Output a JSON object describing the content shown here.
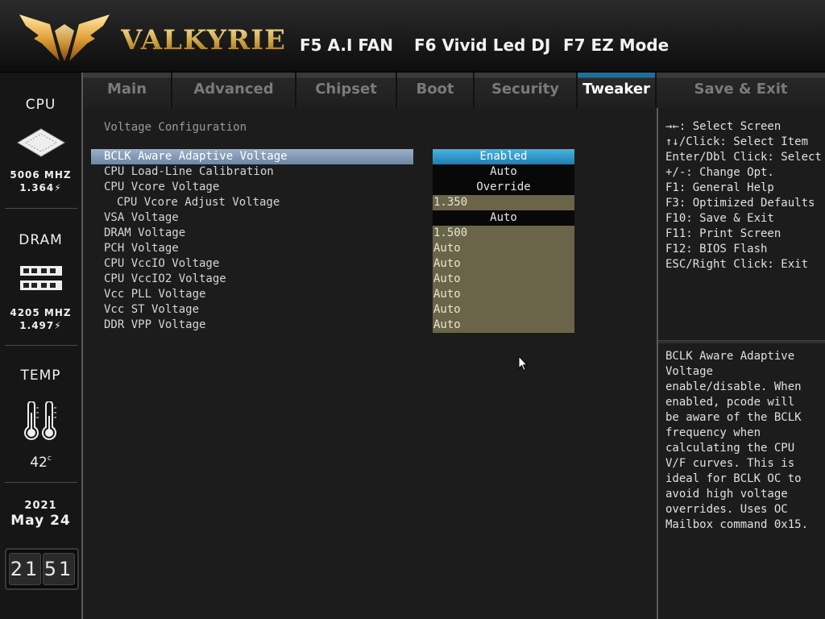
{
  "header": {
    "brand": "VALKYRIE",
    "hotkeys": [
      "F5 A.I FAN",
      "F6 Vivid Led DJ",
      "F7 EZ Mode"
    ]
  },
  "status": {
    "cpu": {
      "title": "CPU",
      "freq": "5006 MHZ",
      "volt": "1.364"
    },
    "dram": {
      "title": "DRAM",
      "freq": "4205 MHZ",
      "volt": "1.497"
    },
    "temp": {
      "title": "TEMP",
      "value": "42"
    },
    "date": {
      "year": "2021",
      "monthday": "May 24"
    },
    "time": {
      "hh": "21",
      "mm": "51"
    }
  },
  "tabs": [
    "Main",
    "Advanced",
    "Chipset",
    "Boot",
    "Security",
    "Tweaker",
    "Save & Exit"
  ],
  "active_tab": "Tweaker",
  "main": {
    "title": "Voltage Configuration",
    "rows": [
      {
        "label": "BCLK Aware Adaptive Voltage",
        "value": "Enabled",
        "kind": "option",
        "selected": true
      },
      {
        "label": "CPU Load-Line Calibration",
        "value": "Auto",
        "kind": "option"
      },
      {
        "label": "CPU Vcore Voltage",
        "value": "Override",
        "kind": "option"
      },
      {
        "label": "CPU Vcore Adjust Voltage",
        "value": "1.350",
        "kind": "number",
        "indent": true
      },
      {
        "label": "VSA Voltage",
        "value": "Auto",
        "kind": "option"
      },
      {
        "label": "DRAM Voltage",
        "value": "1.500",
        "kind": "number"
      },
      {
        "label": "PCH Voltage",
        "value": "Auto",
        "kind": "number"
      },
      {
        "label": "CPU VccIO Voltage",
        "value": "Auto",
        "kind": "number"
      },
      {
        "label": "CPU VccIO2 Voltage",
        "value": "Auto",
        "kind": "number"
      },
      {
        "label": "Vcc PLL Voltage",
        "value": "Auto",
        "kind": "number"
      },
      {
        "label": "Vcc ST Voltage",
        "value": "Auto",
        "kind": "number"
      },
      {
        "label": "DDR VPP Voltage",
        "value": "Auto",
        "kind": "number"
      }
    ]
  },
  "help": {
    "keys": [
      "→←: Select Screen",
      "↑↓/Click: Select Item",
      "Enter/Dbl Click: Select",
      "+/-: Change Opt.",
      "F1: General Help",
      "F3: Optimized Defaults",
      "F10: Save & Exit",
      "F11: Print Screen",
      "F12: BIOS Flash",
      "ESC/Right Click: Exit"
    ],
    "description": "BCLK Aware Adaptive\nVoltage\nenable/disable. When\nenabled, pcode will\nbe aware of the BCLK\nfrequency when\ncalculating the CPU\nV/F curves. This is\nideal for BCLK OC to\navoid high voltage\noverrides. Uses OC\nMailbox command 0x15."
  },
  "colors": {
    "accent": "#1e7fb3",
    "numeric_field": "#6a6448",
    "brand_gold": "#e0bf6a"
  }
}
